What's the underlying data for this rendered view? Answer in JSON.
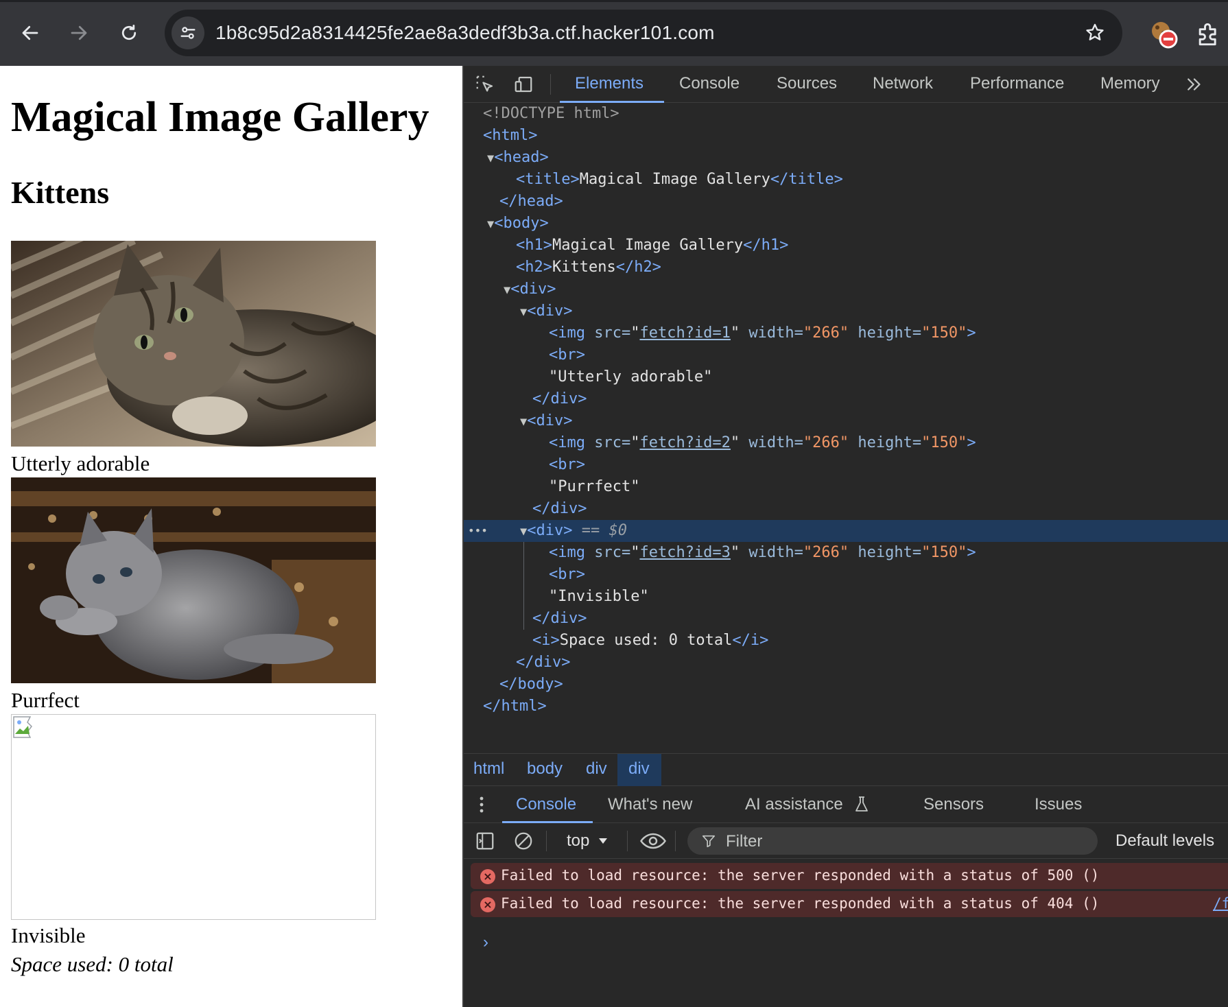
{
  "browser": {
    "url": "1b8c95d2a8314425fe2ae8a3dedf3b3a.ctf.hacker101.com"
  },
  "page": {
    "h1": "Magical Image Gallery",
    "h2": "Kittens",
    "captions": [
      "Utterly adorable",
      "Purrfect",
      "Invisible"
    ],
    "space_used": "Space used: 0 total"
  },
  "devtools": {
    "tabs": [
      "Elements",
      "Console",
      "Sources",
      "Network",
      "Performance",
      "Memory"
    ],
    "active_tab": "Elements",
    "dom": {
      "doctype": "<!DOCTYPE html>",
      "html_open": "<html>",
      "head_open": "<head>",
      "title_open": "<title>",
      "title_text": "Magical Image Gallery",
      "title_close": "</title>",
      "head_close": "</head>",
      "body_open": "<body>",
      "h1_open": "<h1>",
      "h1_text": "Magical Image Gallery",
      "h1_close": "</h1>",
      "h2_open": "<h2>",
      "h2_text": "Kittens",
      "h2_close": "</h2>",
      "div_open": "<div>",
      "div_close": "</div>",
      "img_open": "<img",
      "src_attr": "src=",
      "width_attr": "width=",
      "height_attr": "height=",
      "width_val": "\"266\"",
      "height_val": "\"150\"",
      "img_end": ">",
      "quote": "\"",
      "br": "<br>",
      "img_srcs": [
        "fetch?id=1",
        "fetch?id=2",
        "fetch?id=3"
      ],
      "texts": [
        "\"Utterly adorable\"",
        "\"Purrfect\"",
        "\"Invisible\""
      ],
      "selected_marker": "== $0",
      "i_open": "<i>",
      "i_text": "Space used: 0 total",
      "i_close": "</i>",
      "body_close": "</body>",
      "html_close": "</html>",
      "ellipsis": "•••"
    },
    "breadcrumbs": [
      "html",
      "body",
      "div",
      "div"
    ],
    "drawer_tabs": [
      "Console",
      "What's new",
      "AI assistance",
      "Sensors",
      "Issues"
    ],
    "console": {
      "context": "top",
      "filter_placeholder": "Filter",
      "levels": "Default levels",
      "errors": [
        {
          "text": "Failed to load resource: the server responded with a status of 500 ()",
          "link": ""
        },
        {
          "text": "Failed to load resource: the server responded with a status of 404 ()",
          "link": "/fa"
        }
      ],
      "prompt": "›",
      "error_glyph": "×"
    }
  },
  "colors": {
    "chrome_bg": "#35363a",
    "devtools_bg": "#282828",
    "tag_blue": "#7cacf8",
    "attr_value_orange": "#f29766",
    "selected_row": "#1f3a5c",
    "error_row": "#4e2a2a"
  }
}
